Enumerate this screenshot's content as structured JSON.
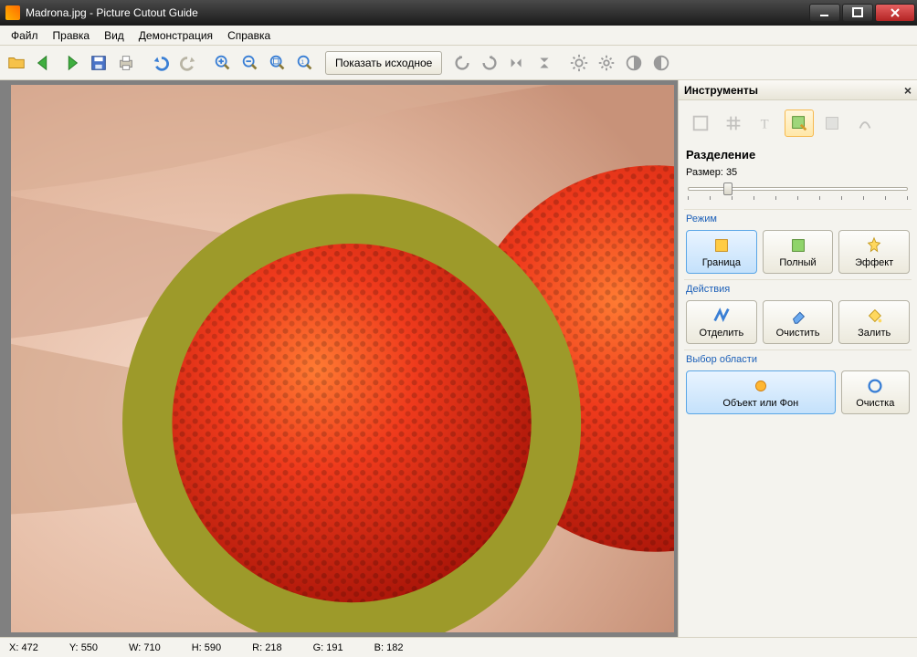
{
  "window": {
    "title": "Madrona.jpg - Picture Cutout Guide"
  },
  "menu": {
    "file": "Файл",
    "edit": "Правка",
    "view": "Вид",
    "demo": "Демонстрация",
    "help": "Справка"
  },
  "toolbar": {
    "show_original": "Показать исходное"
  },
  "panel": {
    "title": "Инструменты",
    "section": "Разделение",
    "size_label": "Размер:",
    "size_value": "35",
    "groups": {
      "mode": "Режим",
      "actions": "Действия",
      "selection": "Выбор области"
    },
    "mode": {
      "boundary": "Граница",
      "full": "Полный",
      "effect": "Эффект"
    },
    "actions": {
      "separate": "Отделить",
      "clear": "Очистить",
      "fill": "Залить"
    },
    "selection": {
      "object_or_bg": "Объект или Фон",
      "cleanup": "Очистка"
    }
  },
  "status": {
    "x_label": "X:",
    "x": "472",
    "y_label": "Y:",
    "y": "550",
    "w_label": "W:",
    "w": "710",
    "h_label": "H:",
    "h": "590",
    "r_label": "R:",
    "r": "218",
    "g_label": "G:",
    "g": "191",
    "b_label": "B:",
    "b": "182"
  },
  "slider": {
    "percent": 16
  }
}
